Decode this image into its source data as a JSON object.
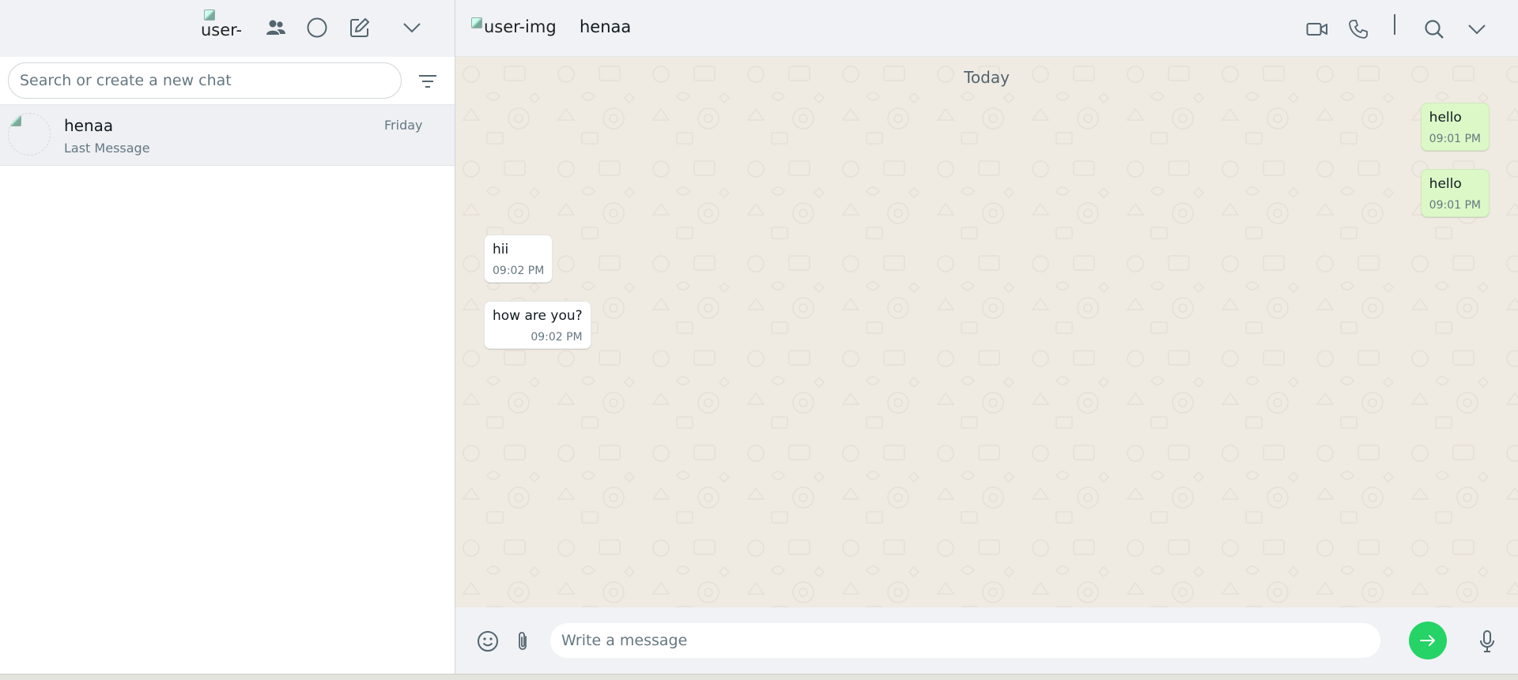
{
  "colors": {
    "header_bg": "#f0f2f5",
    "chat_bg": "#efeae2",
    "outgoing_bubble": "#dbf8c6",
    "incoming_bubble": "#ffffff",
    "send_button": "#25d366",
    "icon": "#54656f"
  },
  "left": {
    "header": {
      "my_avatar_alt": "user-",
      "icons": [
        "community-icon",
        "status-icon",
        "new-chat-icon",
        "menu-chevron-icon"
      ]
    },
    "search": {
      "placeholder": "Search or create a new chat",
      "filter_icon": "filter-icon"
    },
    "chats": [
      {
        "name": "henaa",
        "last_message": "Last Message",
        "time": "Friday"
      }
    ]
  },
  "conversation": {
    "header": {
      "avatar_alt": "user-img",
      "contact_name": "henaa",
      "icons": [
        "video-call-icon",
        "voice-call-icon",
        "search-icon",
        "menu-chevron-icon"
      ]
    },
    "day_label": "Today",
    "messages": [
      {
        "direction": "out",
        "text": "hello",
        "time": "09:01 PM"
      },
      {
        "direction": "out",
        "text": "hello",
        "time": "09:01 PM"
      },
      {
        "direction": "in",
        "text": "hii",
        "time": "09:02 PM"
      },
      {
        "direction": "in",
        "text": "how are you?",
        "time": "09:02 PM"
      }
    ],
    "composer": {
      "placeholder": "Write a message",
      "icons": [
        "emoji-icon",
        "attach-icon",
        "send-icon",
        "microphone-icon"
      ]
    }
  }
}
